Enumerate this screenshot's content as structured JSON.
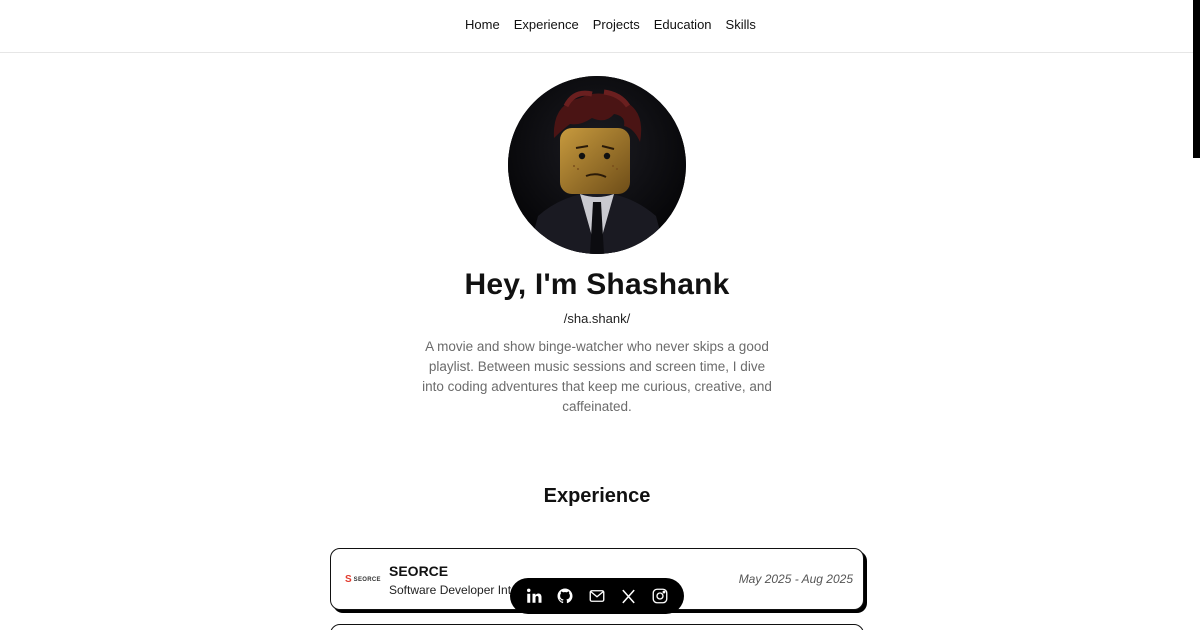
{
  "nav": {
    "items": [
      {
        "label": "Home"
      },
      {
        "label": "Experience"
      },
      {
        "label": "Projects"
      },
      {
        "label": "Education"
      },
      {
        "label": "Skills"
      }
    ]
  },
  "hero": {
    "title": "Hey, I'm Shashank",
    "pronunciation": "/sha.shank/",
    "bio": "A movie and show binge-watcher who never skips a good playlist. Between music sessions and screen time, I dive into coding adventures that keep me curious, creative, and caffeinated."
  },
  "experience": {
    "heading": "Experience",
    "items": [
      {
        "logo_mark": "S",
        "logo_text": "SEORCE",
        "company": "SEORCE",
        "role": "Software Developer Intern",
        "dates": "May 2025 - Aug 2025"
      }
    ]
  },
  "social": {
    "icons": [
      "linkedin-icon",
      "github-icon",
      "mail-icon",
      "x-icon",
      "instagram-icon"
    ]
  },
  "colors": {
    "accent": "#000000",
    "logo_red": "#e23b2e",
    "muted_text": "#6b6b6b"
  }
}
